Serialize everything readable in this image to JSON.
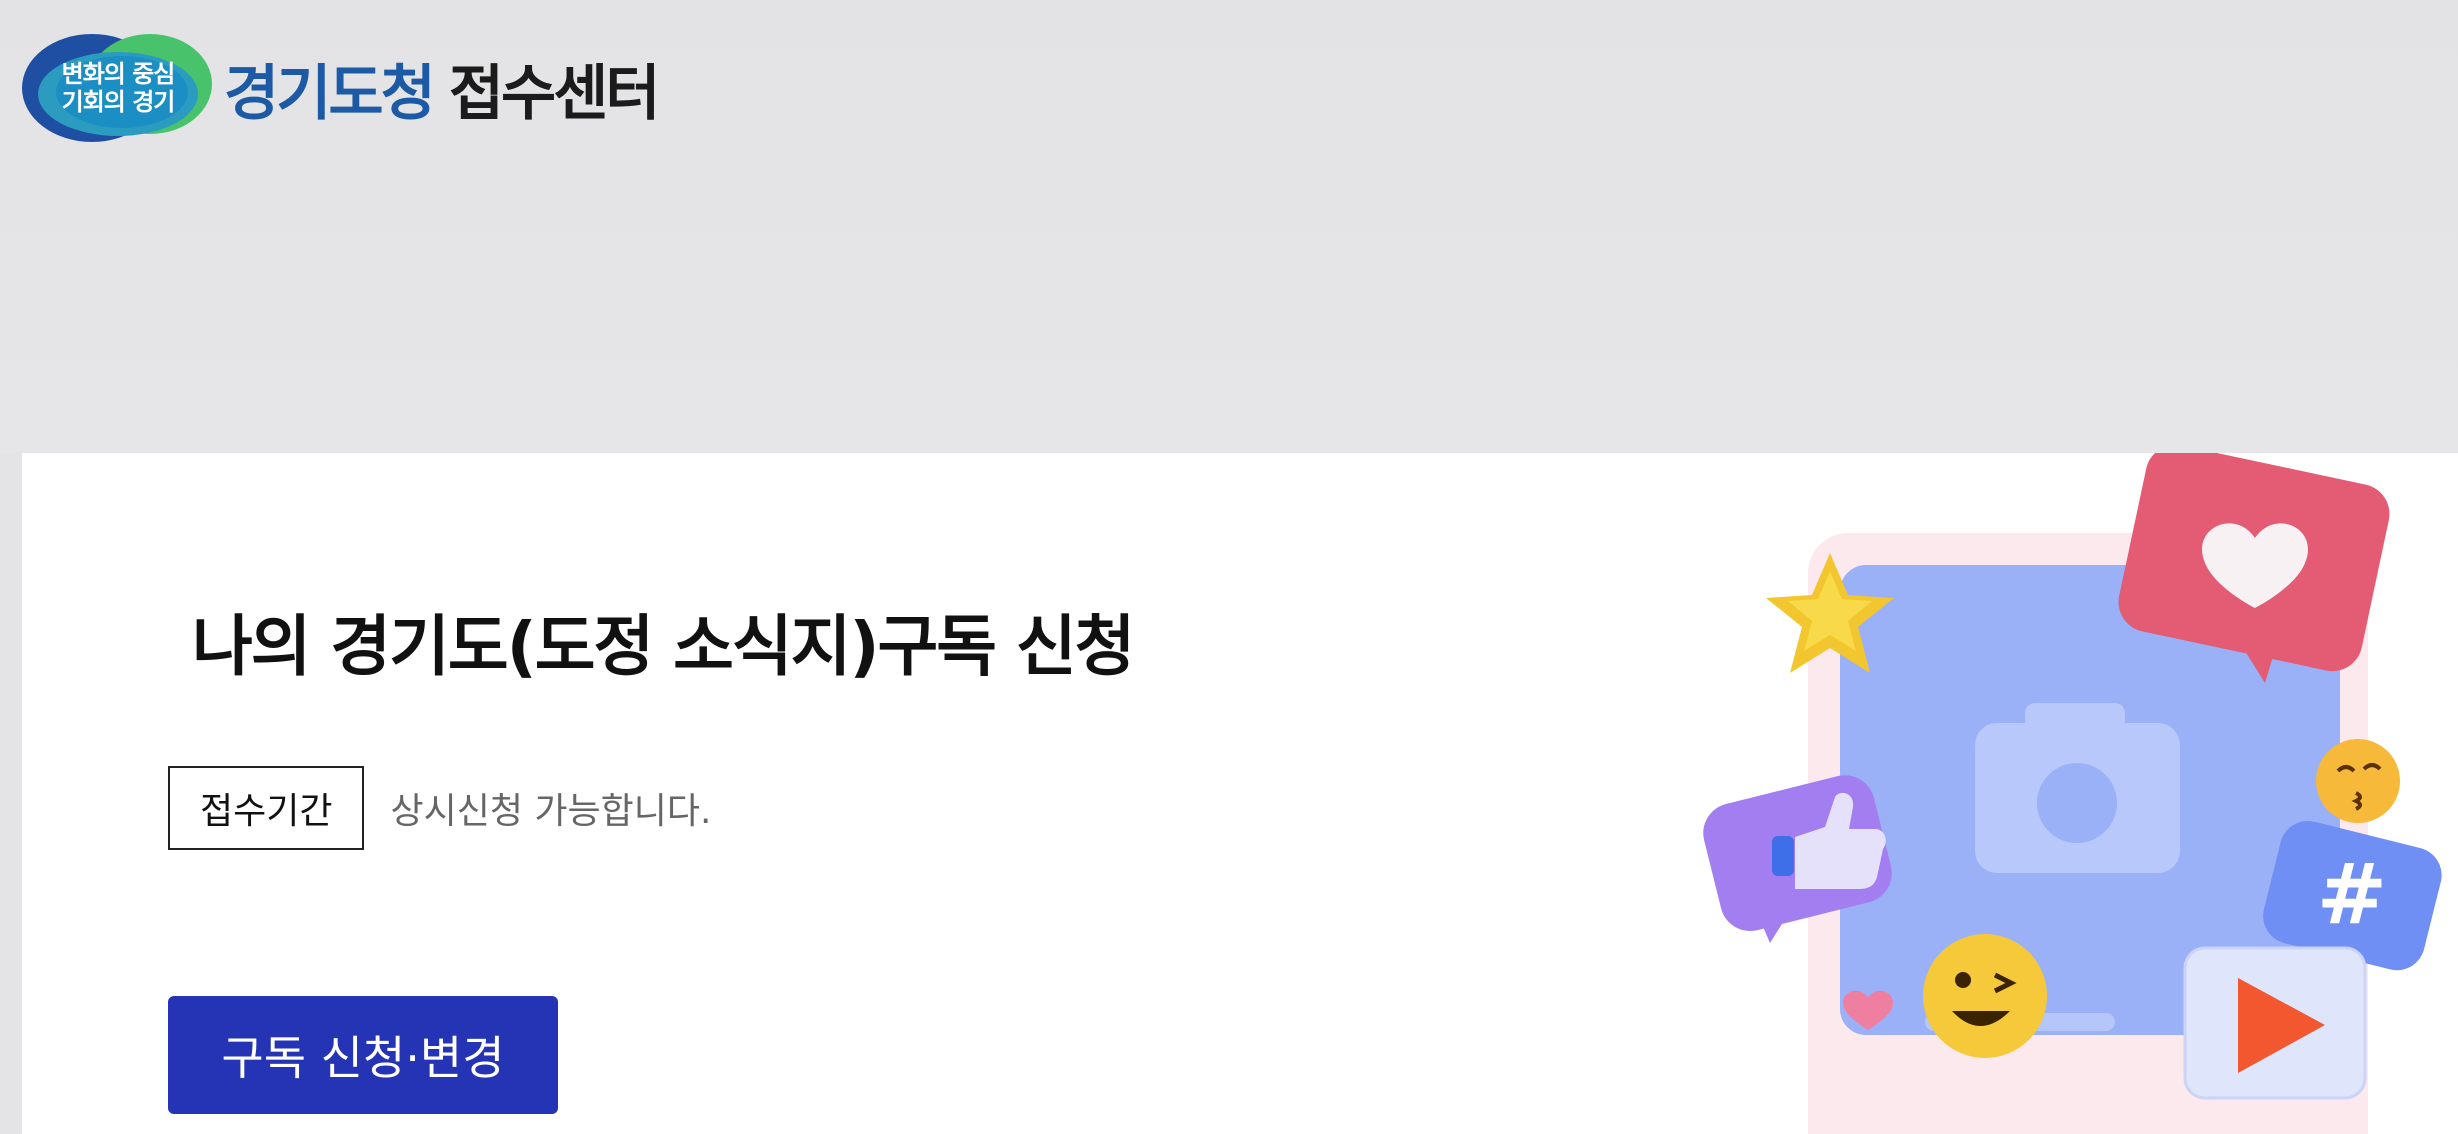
{
  "header": {
    "logo": {
      "slogan_line1": "변화의 중심",
      "slogan_line2": "기회의 경기",
      "org_name": "경기도청",
      "service_name": "접수센터"
    }
  },
  "main": {
    "title": "나의 경기도(도정 소식지)구독 신청",
    "period_label": "접수기간",
    "period_text": "상시신청 가능합니다.",
    "subscribe_button_label": "구독 신청·변경"
  },
  "illustration": {
    "icons": [
      "camera-icon",
      "heart-icon",
      "star-icon",
      "thumbs-up-icon",
      "hashtag-icon",
      "play-icon",
      "kiss-emoji-icon",
      "wink-emoji-icon"
    ]
  },
  "colors": {
    "header_bg": "#e4e4e6",
    "brand_blue": "#1d5aa6",
    "button_bg": "#2533b5",
    "button_text": "#ffffff"
  }
}
